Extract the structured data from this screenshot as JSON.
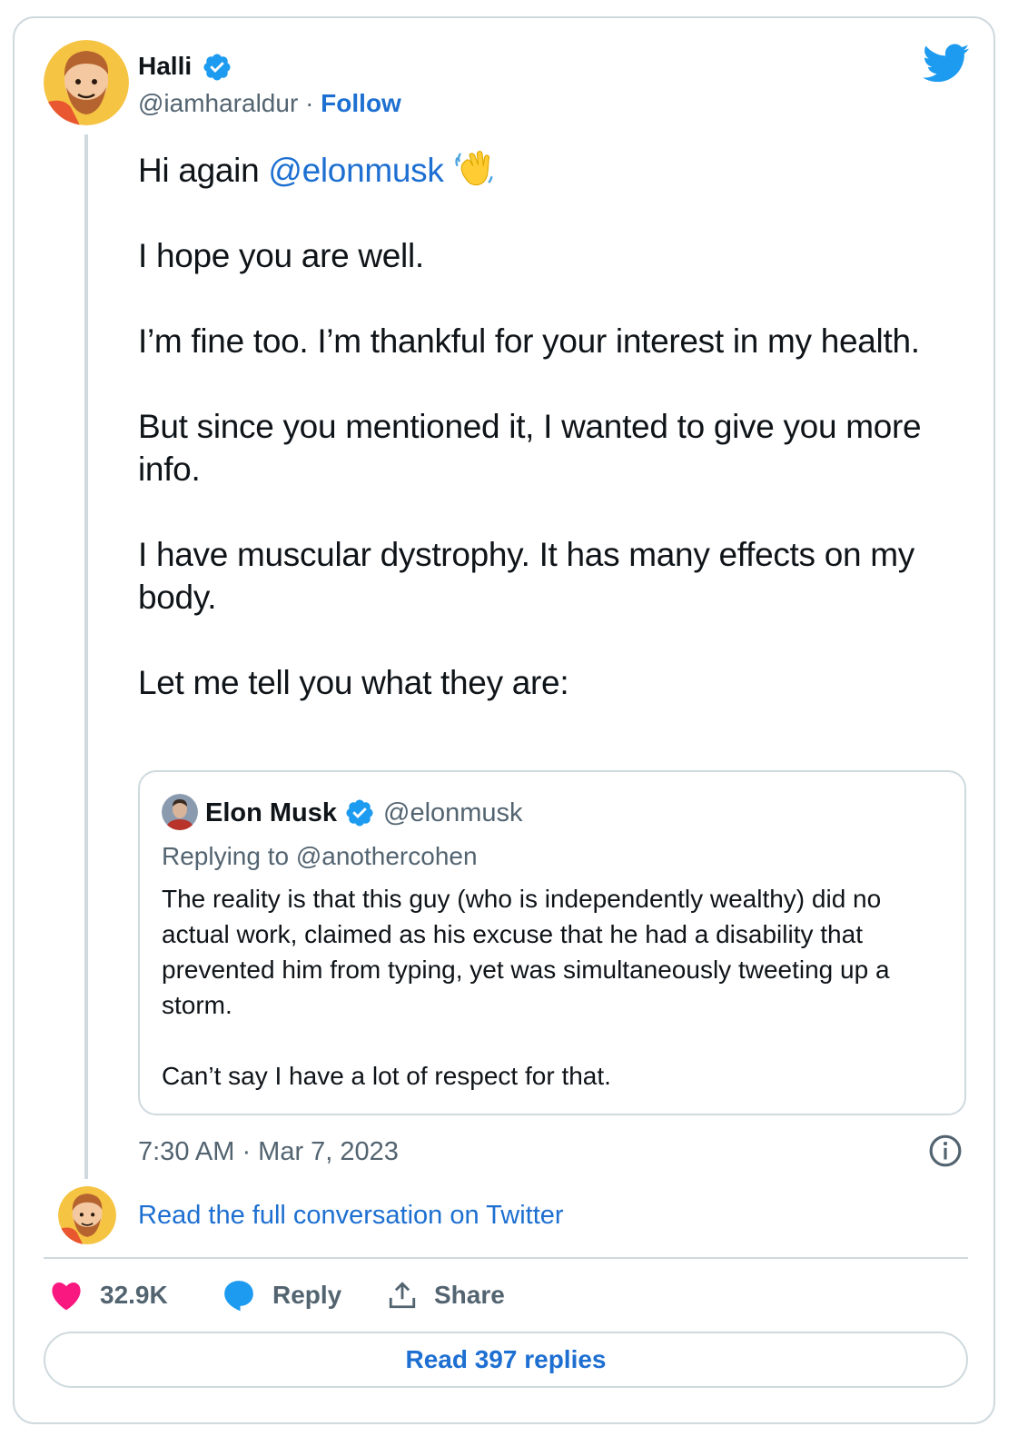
{
  "author": {
    "name": "Halli",
    "handle": "@iamharaldur",
    "separator": "·",
    "follow_label": "Follow"
  },
  "tweet": {
    "line1_prefix": "Hi again ",
    "line1_mention": "@elonmusk",
    "paragraphs": [
      "I hope you are well.",
      "I’m fine too. I’m thankful for your interest in my health.",
      "But since you mentioned it, I wanted to give you more info.",
      "I have muscular dystrophy. It has many effects on my body.",
      "Let me tell you what they are:"
    ]
  },
  "quoted": {
    "name": "Elon Musk",
    "handle": "@elonmusk",
    "replying_to": "Replying to @anothercohen",
    "paragraphs": [
      "The reality is that this guy (who is independently wealthy) did no actual work, claimed as his excuse that he had a disability that prevented him from typing, yet was simultaneously tweeting up a storm.",
      "Can’t say I have a lot of respect for that."
    ]
  },
  "timestamp": "7:30 AM · Mar 7, 2023",
  "read_full_label": "Read the full conversation on Twitter",
  "actions": {
    "likes": "32.9K",
    "reply_label": "Reply",
    "share_label": "Share"
  },
  "read_replies_label": "Read 397 replies",
  "colors": {
    "link_blue": "#1d6fd1",
    "verified_blue": "#1d9bf0",
    "like_pink": "#f91880",
    "muted": "#536471",
    "border": "#cfd9de"
  },
  "icons": [
    "verified-badge-icon",
    "twitter-bird-icon",
    "waving-hand-icon",
    "info-icon",
    "heart-icon",
    "speech-bubble-icon",
    "share-icon"
  ]
}
